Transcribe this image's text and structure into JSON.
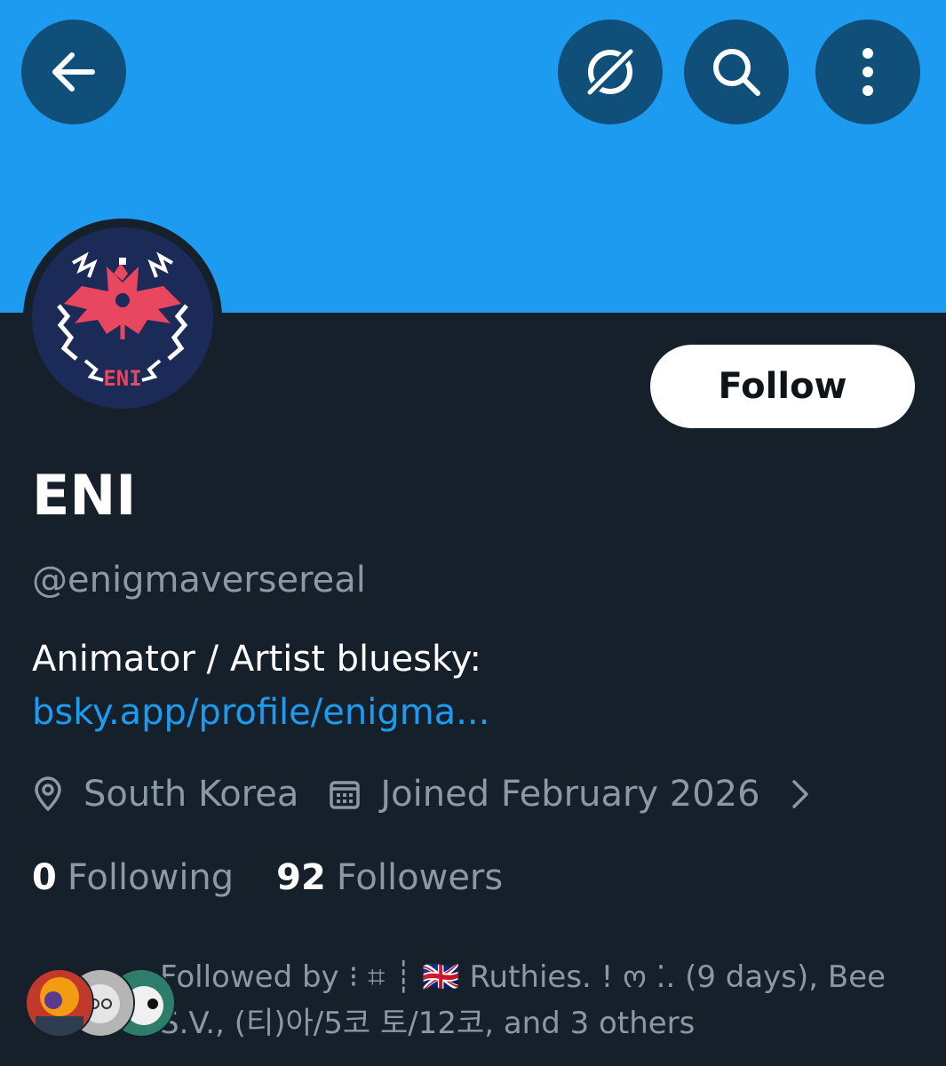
{
  "header": {
    "back_icon": "arrow-left-icon",
    "grok_icon": "grok-icon",
    "search_icon": "search-icon",
    "more_icon": "more-vertical-icon",
    "banner_color": "#1d9bf0"
  },
  "profile": {
    "avatar_text": "ENI",
    "follow_label": "Follow",
    "display_name": "ENI",
    "handle": "@enigmaversereal",
    "bio_text": "Animator / Artist  bluesky: ",
    "bio_link": "bsky.app/profile/enigma...",
    "location_icon": "location-pin-icon",
    "location": "South Korea",
    "calendar_icon": "calendar-icon",
    "joined": "Joined February 2026",
    "chevron_icon": "chevron-right-icon"
  },
  "stats": {
    "following_count": "0",
    "following_label": "Following",
    "followers_count": "92",
    "followers_label": "Followers"
  },
  "followed_by": {
    "text": "Followed by ⁝ ⌗ ┊ 🇬🇧 Ruthies. ! ო ⁚. (9 days), Bee S.V., (티)아/5코 토/12코, and 3 others"
  },
  "colors": {
    "background": "#15202b",
    "accent": "#1d9bf0",
    "muted_text": "#8b98a5",
    "button_bg": "#0f4f7a"
  }
}
